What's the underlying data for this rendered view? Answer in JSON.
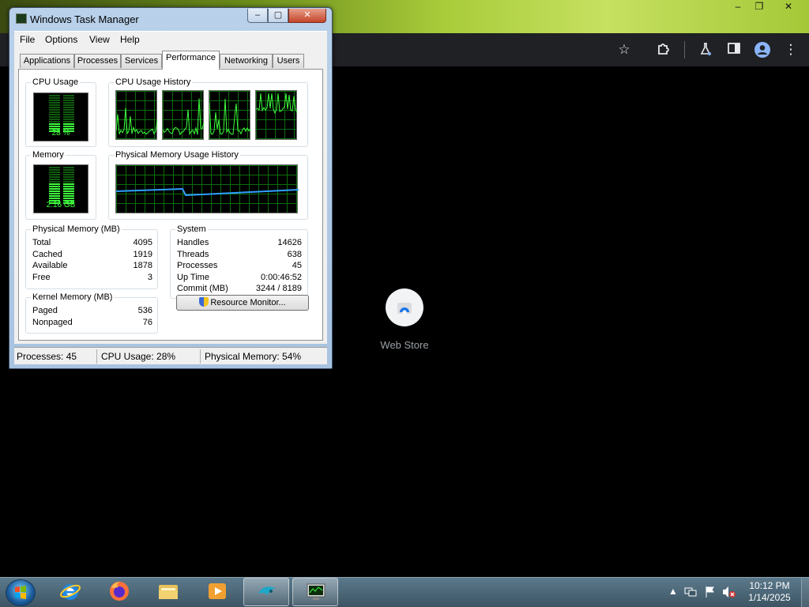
{
  "taskmgr": {
    "title": "Windows Task Manager",
    "window_controls": {
      "minimize": "–",
      "maximize": "▢",
      "close": "✕"
    },
    "menu": [
      "File",
      "Options",
      "View",
      "Help"
    ],
    "tabs": [
      "Applications",
      "Processes",
      "Services",
      "Performance",
      "Networking",
      "Users"
    ],
    "active_tab": "Performance",
    "cpu_usage": {
      "label": "CPU Usage",
      "value": "28 %",
      "fraction": 0.28
    },
    "cpu_history": {
      "label": "CPU Usage History",
      "cores": 4
    },
    "memory": {
      "label": "Memory",
      "value": "2.16 GB",
      "fraction": 0.54
    },
    "mem_history": {
      "label": "Physical Memory Usage History"
    },
    "physical_memory": {
      "label": "Physical Memory (MB)",
      "rows": [
        {
          "k": "Total",
          "v": "4095"
        },
        {
          "k": "Cached",
          "v": "1919"
        },
        {
          "k": "Available",
          "v": "1878"
        },
        {
          "k": "Free",
          "v": "3"
        }
      ]
    },
    "system": {
      "label": "System",
      "rows": [
        {
          "k": "Handles",
          "v": "14626"
        },
        {
          "k": "Threads",
          "v": "638"
        },
        {
          "k": "Processes",
          "v": "45"
        },
        {
          "k": "Up Time",
          "v": "0:00:46:52"
        },
        {
          "k": "Commit (MB)",
          "v": "3244 / 8189"
        }
      ]
    },
    "kernel_memory": {
      "label": "Kernel Memory (MB)",
      "rows": [
        {
          "k": "Paged",
          "v": "536"
        },
        {
          "k": "Nonpaged",
          "v": "76"
        }
      ]
    },
    "resource_monitor_button": "Resource Monitor...",
    "status": {
      "processes": "Processes: 45",
      "cpu": "CPU Usage: 28%",
      "memory": "Physical Memory: 54%"
    }
  },
  "browser": {
    "webstore_label": "Web Store",
    "window_controls": {
      "minimize": "–",
      "maximize": "❐",
      "close": "✕"
    },
    "toolbar_icons": [
      "star-icon",
      "extension-icon",
      "labs-icon",
      "sidepanel-icon",
      "profile-icon",
      "menu-icon"
    ]
  },
  "taskbar": {
    "apps": [
      "internet-explorer",
      "firefox",
      "windows-explorer",
      "media-player",
      "app-manager",
      "task-manager"
    ],
    "clock_time": "10:12 PM",
    "clock_date": "1/14/2025"
  },
  "colors": {
    "meter_green": "#3dff3d",
    "grid_green": "#0d6d0d",
    "mem_line": "#2f9fff",
    "accent_blue": "#3b6ea5"
  }
}
